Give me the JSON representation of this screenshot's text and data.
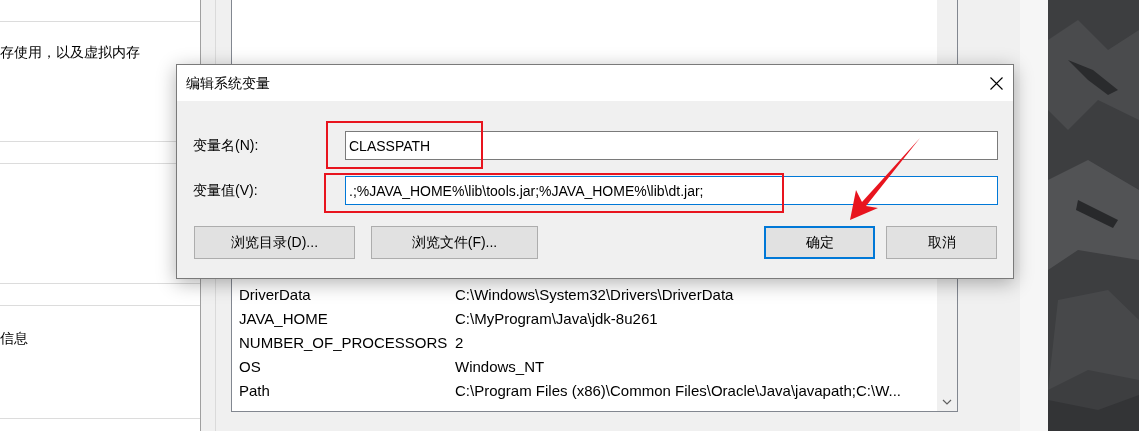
{
  "background": {
    "left_texts": [
      "存使用，以及虚拟内存",
      "信息"
    ],
    "variables": [
      {
        "name": "DriverData",
        "value": "C:\\Windows\\System32\\Drivers\\DriverData"
      },
      {
        "name": "JAVA_HOME",
        "value": "C:\\MyProgram\\Java\\jdk-8u261"
      },
      {
        "name": "NUMBER_OF_PROCESSORS",
        "value": "2"
      },
      {
        "name": "OS",
        "value": "Windows_NT"
      },
      {
        "name": "Path",
        "value": "C:\\Program Files (x86)\\Common Files\\Oracle\\Java\\javapath;C:\\W..."
      }
    ]
  },
  "dialog": {
    "title": "编辑系统变量",
    "fields": [
      {
        "label": "变量名(N):",
        "value": "CLASSPATH",
        "focused": false
      },
      {
        "label": "变量值(V):",
        "value": ".;%JAVA_HOME%\\lib\\tools.jar;%JAVA_HOME%\\lib\\dt.jar;",
        "focused": true
      }
    ],
    "buttons": [
      {
        "label": "浏览目录(D)...",
        "default": false
      },
      {
        "label": "浏览文件(F)...",
        "default": false
      },
      {
        "label": "确定",
        "default": true
      },
      {
        "label": "取消",
        "default": false
      }
    ]
  }
}
